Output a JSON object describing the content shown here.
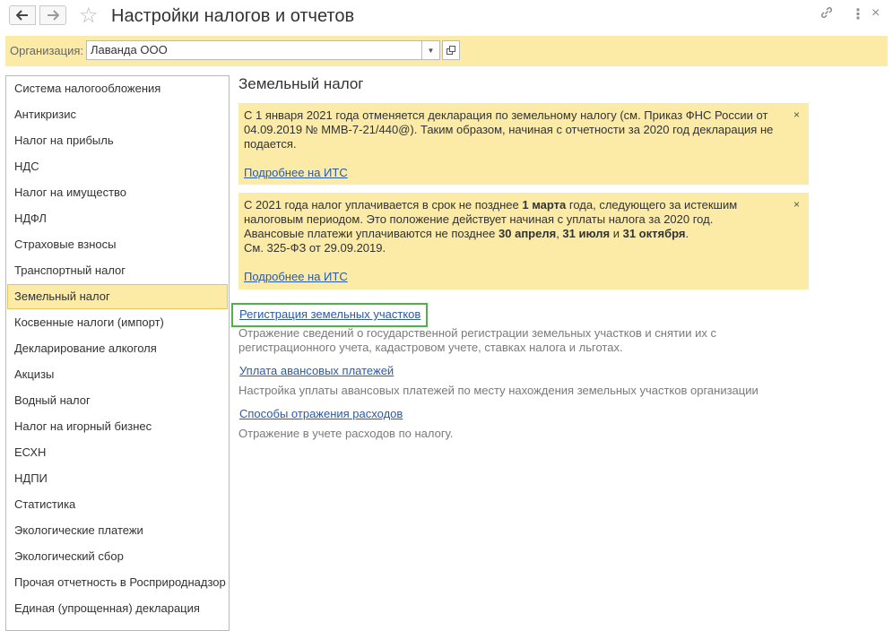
{
  "window": {
    "title": "Настройки налогов и отчетов",
    "icons": {
      "back": "arrow-left-icon",
      "forward": "arrow-right-icon",
      "favorite": "star-icon",
      "link": "link-icon",
      "more": "more-vertical-icon",
      "close": "close-icon"
    }
  },
  "org": {
    "label": "Организация:",
    "value": "Лаванда ООО"
  },
  "sidebar": {
    "selected_index": 8,
    "items": [
      "Система налогообложения",
      "Антикризис",
      "Налог на прибыль",
      "НДС",
      "Налог на имущество",
      "НДФЛ",
      "Страховые взносы",
      "Транспортный налог",
      "Земельный налог",
      "Косвенные налоги (импорт)",
      "Декларирование алкоголя",
      "Акцизы",
      "Водный налог",
      "Налог на игорный бизнес",
      "ЕСХН",
      "НДПИ",
      "Статистика",
      "Экологические платежи",
      "Экологический сбор",
      "Прочая отчетность в Росприроднадзор",
      "Единая (упрощенная) декларация"
    ]
  },
  "main": {
    "heading": "Земельный налог",
    "notice1": {
      "text": "С 1 января 2021 года отменяется декларация по земельному налогу (см. Приказ ФНС России от 04.09.2019 № ММВ-7-21/440@). Таким образом, начиная с отчетности за 2020 год декларация не подается.",
      "more": "Подробнее на ИТС",
      "close": "×"
    },
    "notice2": {
      "p1_a": "С 2021 года налог уплачивается в срок не позднее ",
      "p1_b": "1 марта",
      "p1_c": " года, следующего за истекшим налоговым периодом. Это положение действует начиная с уплаты налога за 2020 год.",
      "p2_a": "Авансовые платежи уплачиваются не позднее ",
      "p2_b": "30 апреля",
      "p2_c": ", ",
      "p2_d": "31 июля",
      "p2_e": " и ",
      "p2_f": "31 октября",
      "p2_g": ".",
      "p3": "См. 325-ФЗ от 29.09.2019.",
      "more": "Подробнее на ИТС",
      "close": "×"
    },
    "links": [
      {
        "label": "Регистрация земельных участков",
        "desc": "Отражение сведений о государственной регистрации земельных участков и снятии их с регистрационного учета, кадастровом учете, ставках налога и льготах."
      },
      {
        "label": "Уплата авансовых платежей",
        "desc": "Настройка уплаты авансовых платежей по месту нахождения земельных участков организации"
      },
      {
        "label": "Способы отражения расходов",
        "desc": "Отражение в учете расходов по налогу."
      }
    ]
  }
}
